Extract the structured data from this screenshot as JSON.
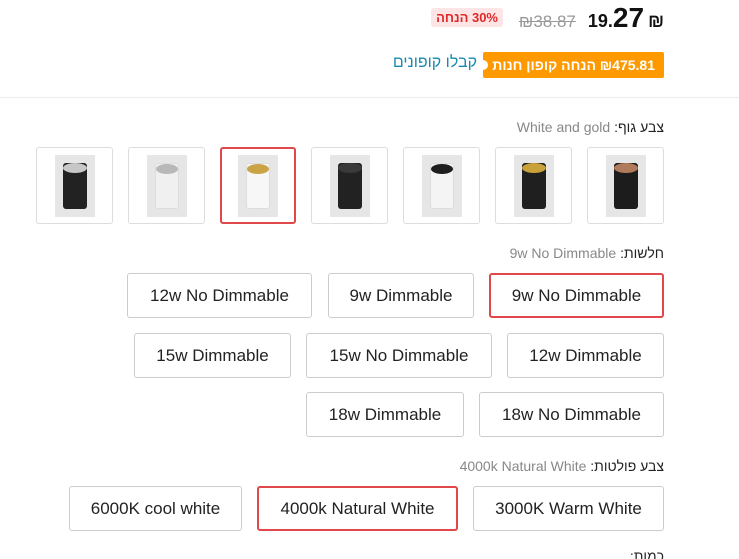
{
  "price": {
    "currency": "₪",
    "integer": "27",
    "decimal": ".19",
    "original": "₪38.87",
    "discount": "30% הנחה"
  },
  "coupon": {
    "badge": "₪475.81 הנחה קופון חנות",
    "link": "קבלו קופונים"
  },
  "body_color": {
    "label": "צבע גוף:",
    "selected_value": "White and gold",
    "swatches": [
      {
        "name": "black-copper",
        "body": "#1c1c1c",
        "rim": "#b07a5c"
      },
      {
        "name": "black-gold",
        "body": "#1f1f1f",
        "rim": "#c9a13b"
      },
      {
        "name": "white-black",
        "body": "#f4f4f4",
        "rim": "#1e1e1e"
      },
      {
        "name": "black-black",
        "body": "#222222",
        "rim": "#3a3a3a"
      },
      {
        "name": "white-gold",
        "body": "#f7f7f7",
        "rim": "#caa346"
      },
      {
        "name": "white-silver",
        "body": "#f0f0f0",
        "rim": "#b8b8b8"
      },
      {
        "name": "black-silver",
        "body": "#222222",
        "rim": "#c7c7c7"
      }
    ]
  },
  "power": {
    "label": "חלשות:",
    "selected_value": "9w No Dimmable",
    "options": [
      "9w No Dimmable",
      "9w Dimmable",
      "12w No Dimmable",
      "12w Dimmable",
      "15w No Dimmable",
      "15w Dimmable",
      "18w No Dimmable",
      "18w Dimmable"
    ]
  },
  "light_color": {
    "label": "צבע פולטות:",
    "selected_value": "4000k Natural White",
    "options": [
      "3000K Warm White",
      "4000k Natural White",
      "6000K cool white"
    ]
  },
  "cutoff_label": "כמות:",
  "colors": {
    "accent_red": "#e0484b",
    "coupon_orange": "#ff9900",
    "link_blue": "#1a8ab0"
  }
}
